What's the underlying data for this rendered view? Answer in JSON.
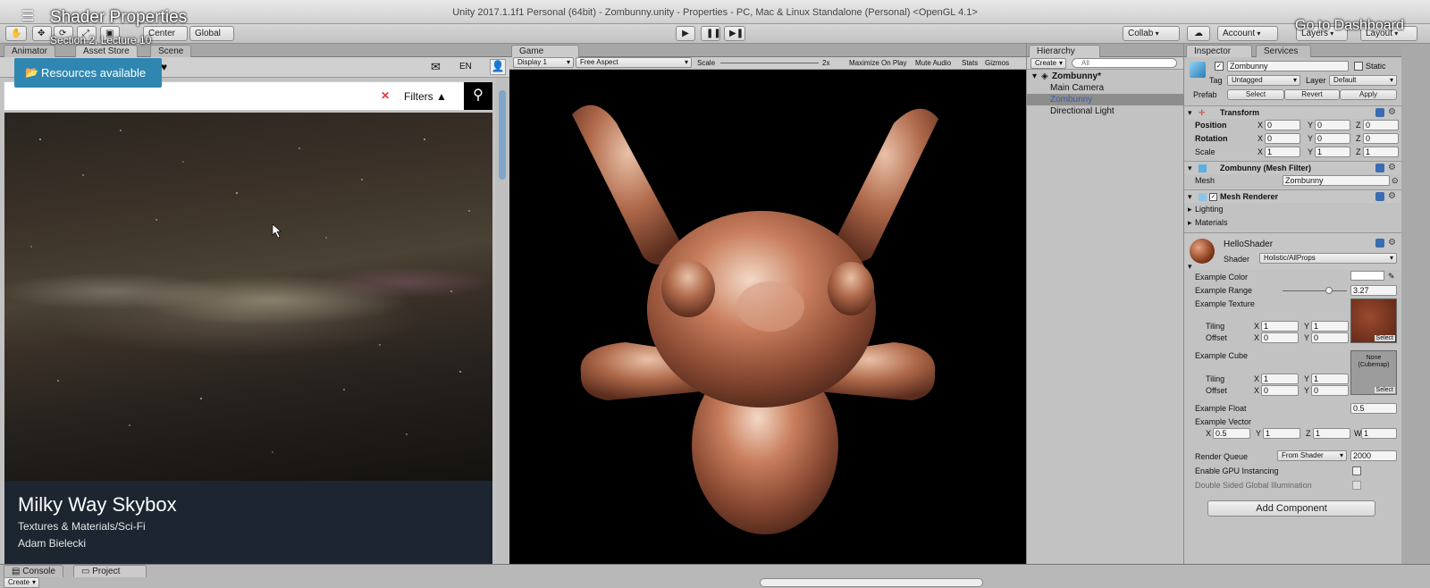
{
  "window": {
    "title": "Unity 2017.1.1f1 Personal (64bit) - Zombunny.unity - Properties - PC, Mac & Linux Standalone (Personal) <OpenGL 4.1>"
  },
  "course": {
    "title": "Shader Properties",
    "lecture": "Section 2, Lecture 10",
    "dashboard": "Go to Dashboard",
    "resources": "Resources available"
  },
  "toolbar": {
    "pivot": "Center",
    "space": "Global",
    "collab": "Collab",
    "account": "Account",
    "layers": "Layers",
    "layout": "Layout"
  },
  "left_tabs": {
    "animator": "Animator",
    "asset_store": "Asset Store",
    "scene": "Scene"
  },
  "store": {
    "lang": "EN",
    "filters": "Filters",
    "asset": {
      "name": "Milky Way Skybox",
      "category": "Textures & Materials/Sci-Fi",
      "author": "Adam Bielecki"
    }
  },
  "game": {
    "tab": "Game",
    "display": "Display 1",
    "aspect": "Free Aspect",
    "scale_label": "Scale",
    "scale_value": "2x",
    "maximize": "Maximize On Play",
    "mute": "Mute Audio",
    "stats": "Stats",
    "gizmos": "Gizmos"
  },
  "hierarchy": {
    "tab": "Hierarchy",
    "create": "Create",
    "search_placeholder": "All",
    "scene": "Zombunny*",
    "items": [
      "Main Camera",
      "Zombunny",
      "Directional Light"
    ]
  },
  "inspector": {
    "tabs": [
      "Inspector",
      "Services"
    ],
    "object_name": "Zombunny",
    "static": "Static",
    "tag_label": "Tag",
    "tag": "Untagged",
    "layer_label": "Layer",
    "layer": "Default",
    "prefab": "Prefab",
    "select": "Select",
    "revert": "Revert",
    "apply": "Apply",
    "transform": {
      "title": "Transform",
      "position": "Position",
      "rotation": "Rotation",
      "scale": "Scale",
      "x": "X",
      "y": "Y",
      "z": "Z",
      "pos": [
        "0",
        "0",
        "0"
      ],
      "rot": [
        "0",
        "0",
        "0"
      ],
      "scl": [
        "1",
        "1",
        "1"
      ]
    },
    "mesh_filter": {
      "title": "Zombunny (Mesh Filter)",
      "mesh_label": "Mesh",
      "mesh": "Zombunny"
    },
    "mesh_renderer": {
      "title": "Mesh Renderer",
      "lighting": "Lighting",
      "materials": "Materials"
    },
    "material": {
      "name": "HelloShader",
      "shader_label": "Shader",
      "shader": "Holistic/AllProps",
      "color": "Example Color",
      "range": "Example Range",
      "range_value": "3.27",
      "range_fraction": 0.72,
      "texture": "Example Texture",
      "tiling": "Tiling",
      "offset": "Offset",
      "tex_tiling": [
        "1",
        "1"
      ],
      "tex_offset": [
        "0",
        "0"
      ],
      "select": "Select",
      "cube": "Example Cube",
      "cube_none": "None",
      "cube_type": "(Cubemap)",
      "cube_tiling": [
        "1",
        "1"
      ],
      "cube_offset": [
        "0",
        "0"
      ],
      "float": "Example Float",
      "float_value": "0.5",
      "vector": "Example Vector",
      "w": "W",
      "vector_values": [
        "0.5",
        "1",
        "1",
        "1"
      ],
      "queue": "Render Queue",
      "queue_mode": "From Shader",
      "queue_value": "2000",
      "gpu": "Enable GPU Instancing",
      "double_sided": "Double Sided Global Illumination"
    },
    "add_component": "Add Component"
  },
  "bottom": {
    "console": "Console",
    "project": "Project",
    "create": "Create"
  }
}
